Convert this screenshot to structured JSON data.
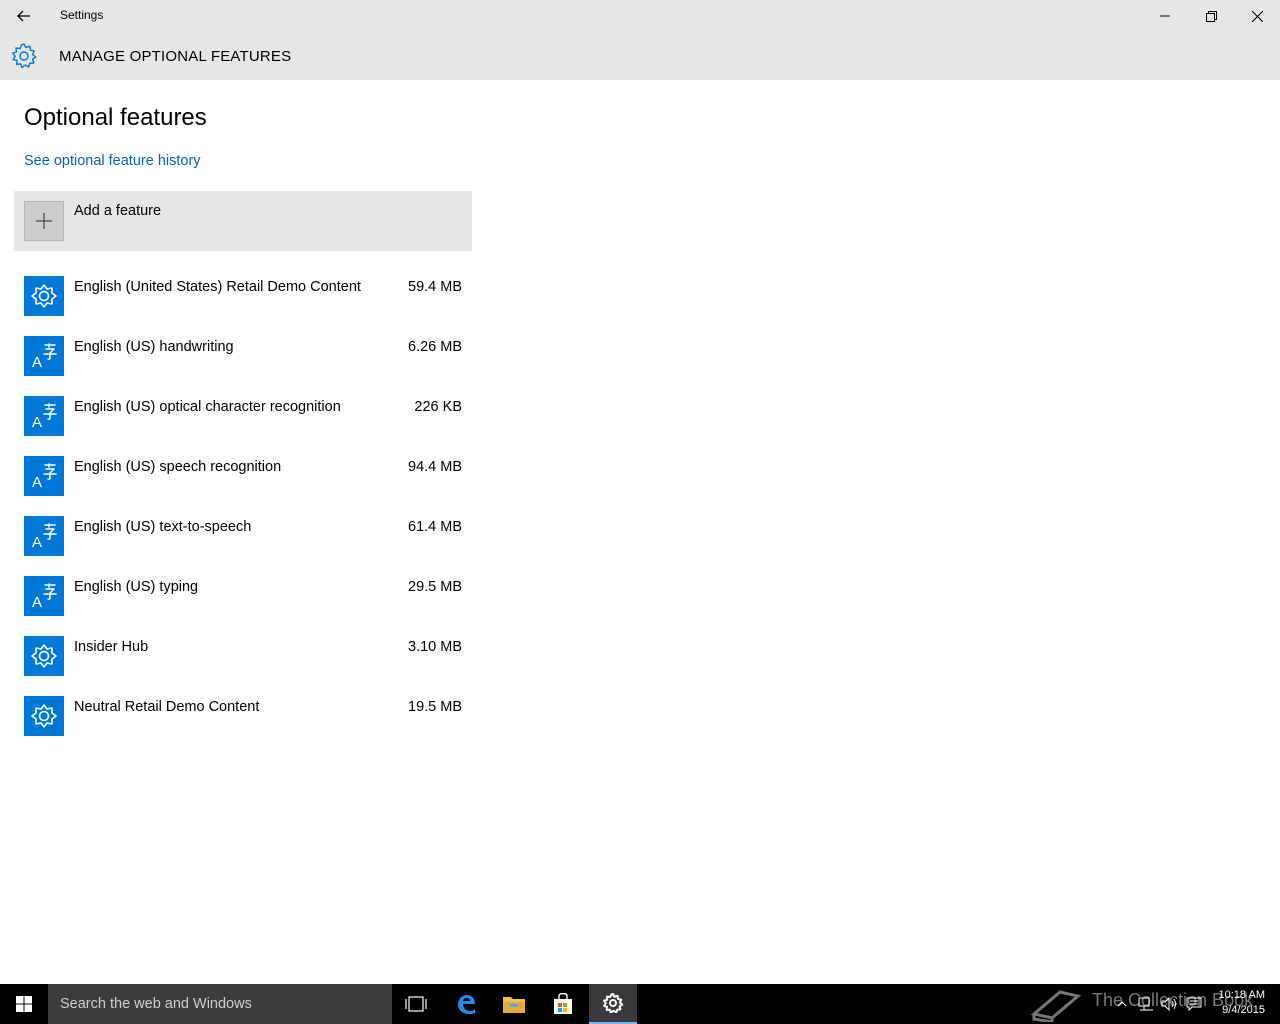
{
  "window": {
    "title": "Settings",
    "back_icon": "arrow-left-icon",
    "controls": [
      "minimize-icon",
      "restore-icon",
      "close-icon"
    ]
  },
  "header": {
    "icon": "gear-icon",
    "title": "MANAGE OPTIONAL FEATURES"
  },
  "main": {
    "title": "Optional features",
    "history_link": "See optional feature history",
    "add_feature": {
      "label": "Add a feature",
      "icon": "plus-icon"
    },
    "features": [
      {
        "name": "English (United States) Retail Demo Content",
        "size": "59.4 MB",
        "icon": "puzzle-icon"
      },
      {
        "name": "English (US) handwriting",
        "size": "6.26 MB",
        "icon": "language-icon"
      },
      {
        "name": "English (US) optical character recognition",
        "size": "226 KB",
        "icon": "language-icon"
      },
      {
        "name": "English (US) speech recognition",
        "size": "94.4 MB",
        "icon": "language-icon"
      },
      {
        "name": "English (US) text-to-speech",
        "size": "61.4 MB",
        "icon": "language-icon"
      },
      {
        "name": "English (US) typing",
        "size": "29.5 MB",
        "icon": "language-icon"
      },
      {
        "name": "Insider Hub",
        "size": "3.10 MB",
        "icon": "puzzle-icon"
      },
      {
        "name": "Neutral Retail Demo Content",
        "size": "19.5 MB",
        "icon": "puzzle-icon"
      }
    ]
  },
  "taskbar": {
    "search_placeholder": "Search the web and Windows",
    "apps": [
      "task-view-icon",
      "edge-icon",
      "file-explorer-icon",
      "store-icon",
      "settings-icon"
    ],
    "watermark": "The Collection Book",
    "clock": {
      "time": "10:18 AM",
      "date": "9/4/2015"
    }
  },
  "colors": {
    "accent": "#0078d7",
    "link": "#0063b1",
    "chrome": "#e6e6e6",
    "taskbar": "#000000"
  }
}
